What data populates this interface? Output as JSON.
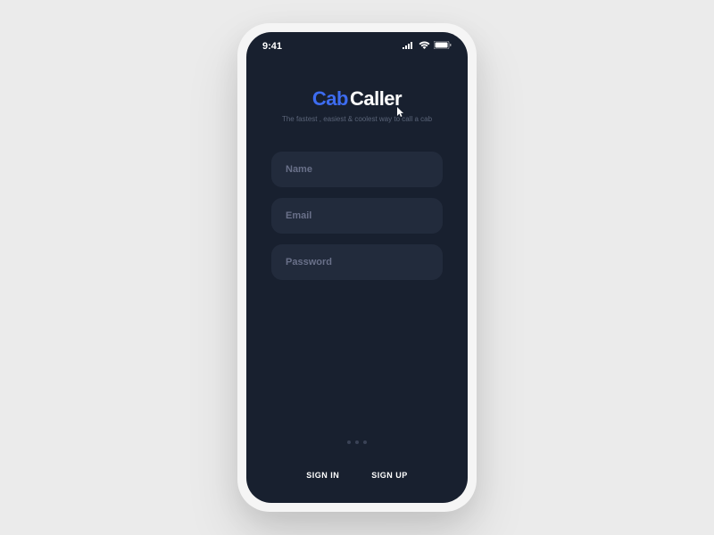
{
  "status": {
    "time": "9:41"
  },
  "brand": {
    "part1": "Cab",
    "part2": "Caller",
    "tagline": "The fastest , easiest &  coolest way to call a cab"
  },
  "form": {
    "name_placeholder": "Name",
    "email_placeholder": "Email",
    "password_placeholder": "Password"
  },
  "footer": {
    "signin": "SIGN IN",
    "signup": "SIGN UP"
  },
  "colors": {
    "accent": "#3d6cf0",
    "screen_bg": "#18202f",
    "input_bg": "#222b3c"
  }
}
